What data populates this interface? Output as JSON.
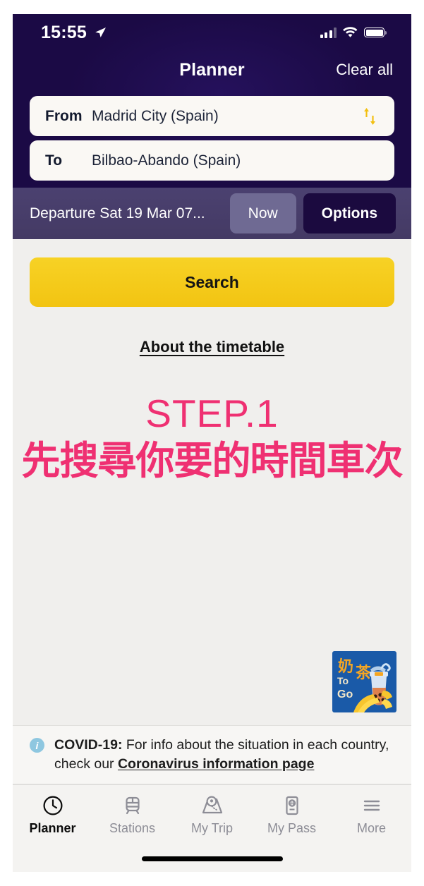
{
  "status_bar": {
    "time": "15:55",
    "location_icon": "location-arrow-icon",
    "signal_icon": "cellular-signal-icon",
    "wifi_icon": "wifi-icon",
    "battery_icon": "battery-full-icon"
  },
  "header": {
    "title": "Planner",
    "clear_all_label": "Clear all",
    "from": {
      "label": "From",
      "value": "Madrid City (Spain)"
    },
    "to": {
      "label": "To",
      "value": "Bilbao-Abando (Spain)"
    },
    "swap_icon": "swap-vertical-arrows-icon"
  },
  "departure_bar": {
    "departure_text": "Departure Sat 19 Mar 07...",
    "now_label": "Now",
    "options_label": "Options"
  },
  "main": {
    "search_label": "Search",
    "about_link_label": "About the timetable",
    "step_title": "STEP.1",
    "step_subtitle": "先搜尋你要的時間車次"
  },
  "logo": {
    "name": "milk-tea-to-go-logo",
    "text_cjk": "奶茶",
    "text_to": "To",
    "text_go": "Go"
  },
  "covid_banner": {
    "info_icon": "info-circle-icon",
    "prefix": "COVID-19:",
    "body": " For info about the situation in each country, check our ",
    "link_label": "Coronavirus information page"
  },
  "tabbar": {
    "items": [
      {
        "label": "Planner",
        "icon": "clock-icon",
        "active": true
      },
      {
        "label": "Stations",
        "icon": "train-icon",
        "active": false
      },
      {
        "label": "My Trip",
        "icon": "map-pin-icon",
        "active": false
      },
      {
        "label": "My Pass",
        "icon": "passport-icon",
        "active": false
      },
      {
        "label": "More",
        "icon": "hamburger-icon",
        "active": false
      }
    ]
  },
  "colors": {
    "header_navy": "#1b0a45",
    "departure_purple": "#453b67",
    "accent_yellow": "#f5cb1d",
    "accent_pink": "#ef3072",
    "options_navy": "#1b0a3f",
    "now_grey": "#6f6a93",
    "body_grey": "#f0efed",
    "logo_blue": "#1a5aa8"
  }
}
